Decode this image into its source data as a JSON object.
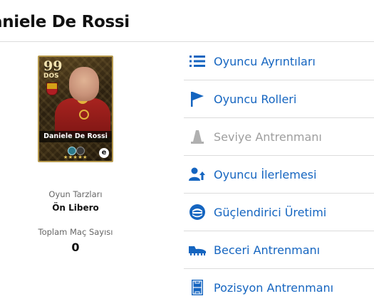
{
  "header": {
    "title": "aniele De Rossi"
  },
  "card": {
    "rating": "99",
    "position": "DOS",
    "name": "Daniele De Rossi",
    "stars": "★★★★★",
    "brand": "e"
  },
  "stats": {
    "play_style_label": "Oyun Tarzları",
    "play_style_value": "Ön Libero",
    "matches_label": "Toplam Maç Sayısı",
    "matches_value": "0"
  },
  "colors": {
    "accent": "#1565c0",
    "disabled": "#9e9e9e",
    "divider": "#dcdcdc"
  },
  "menu": {
    "items": [
      {
        "label": "Oyuncu Ayrıntıları",
        "icon": "list-icon",
        "enabled": true
      },
      {
        "label": "Oyuncu Rolleri",
        "icon": "flag-icon",
        "enabled": true
      },
      {
        "label": "Seviye Antrenmanı",
        "icon": "cone-icon",
        "enabled": false
      },
      {
        "label": "Oyuncu İlerlemesi",
        "icon": "person-progress-icon",
        "enabled": true
      },
      {
        "label": "Güçlendirici Üretimi",
        "icon": "booster-icon",
        "enabled": true
      },
      {
        "label": "Beceri Antrenmanı",
        "icon": "boot-icon",
        "enabled": true
      },
      {
        "label": "Pozisyon Antrenmanı",
        "icon": "pitch-icon",
        "enabled": true
      }
    ]
  }
}
